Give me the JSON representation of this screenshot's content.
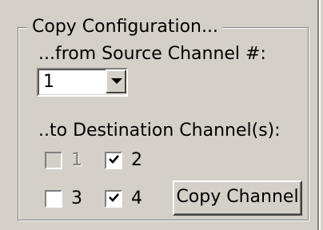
{
  "group": {
    "title": "Copy Configuration..."
  },
  "source": {
    "label": "...from Source Channel #:",
    "selected": "1"
  },
  "destination": {
    "label": "..to Destination Channel(s):",
    "channels": [
      {
        "label": "1",
        "checked": false,
        "enabled": false
      },
      {
        "label": "2",
        "checked": true,
        "enabled": true
      },
      {
        "label": "3",
        "checked": false,
        "enabled": true
      },
      {
        "label": "4",
        "checked": true,
        "enabled": true
      }
    ]
  },
  "actions": {
    "copy_label": "Copy Channel"
  }
}
